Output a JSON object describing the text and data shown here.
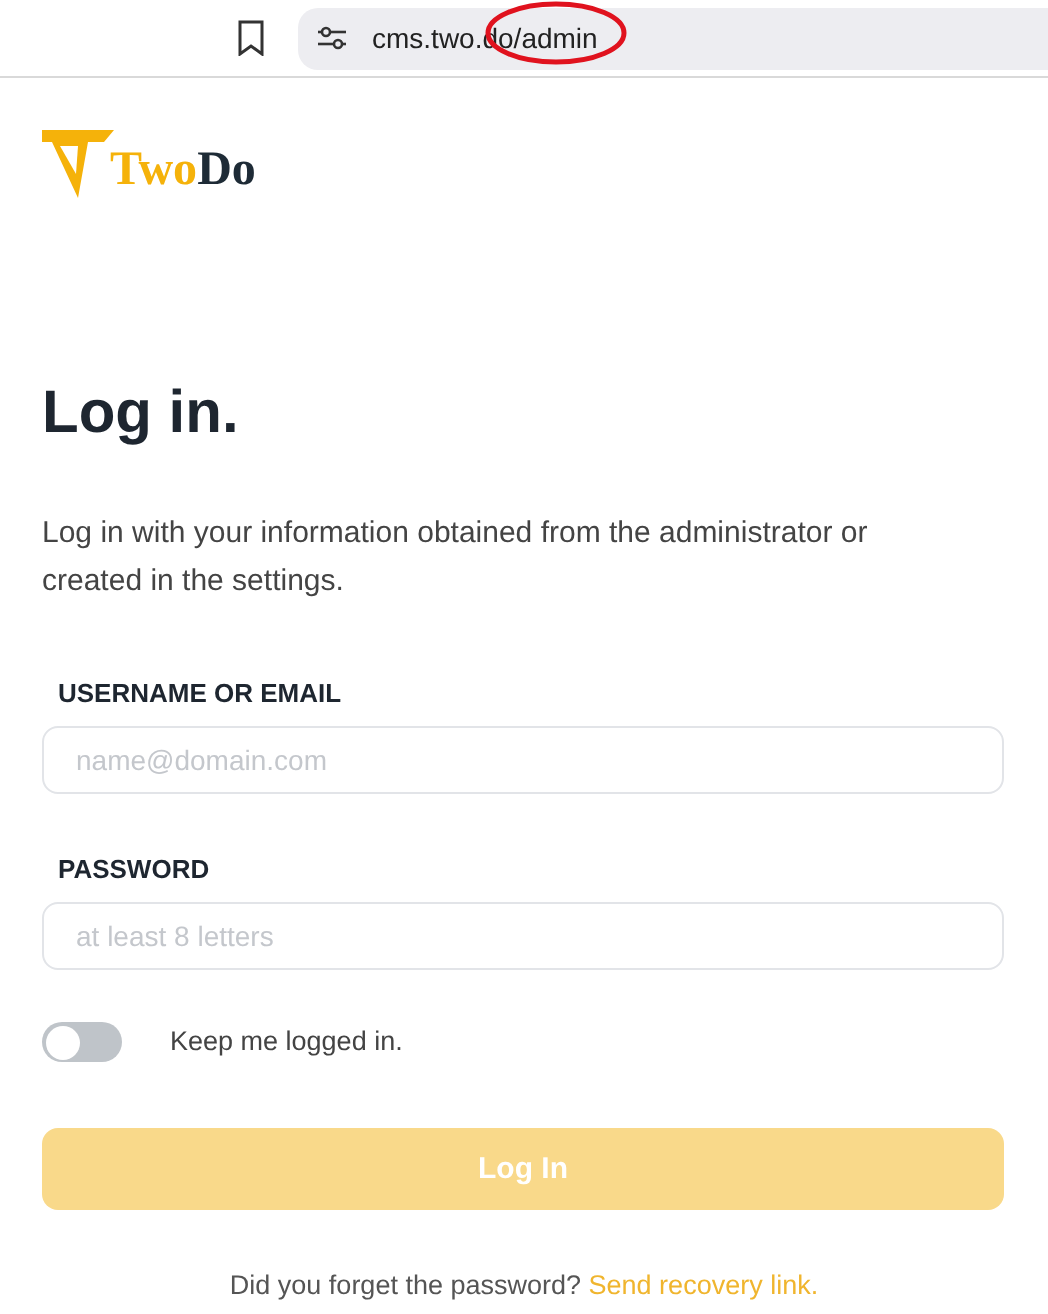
{
  "browser": {
    "url": "cms.two.do/admin",
    "highlighted": true
  },
  "logo": {
    "part_1": "Two",
    "part_2": "Do"
  },
  "title": "Log in.",
  "intro": "Log in with your information obtained from the administrator or created in the settings.",
  "fields": [
    {
      "label": "USERNAME OR EMAIL",
      "placeholder": "name@domain.com"
    },
    {
      "label": "PASSWORD",
      "placeholder": "at least 8 letters"
    }
  ],
  "remember": {
    "label": "Keep me logged in.",
    "checked": false
  },
  "submit": {
    "label": "Log In",
    "disabled": true
  },
  "footer": {
    "text": "Did you forget the password?",
    "link": "Send recovery link."
  }
}
